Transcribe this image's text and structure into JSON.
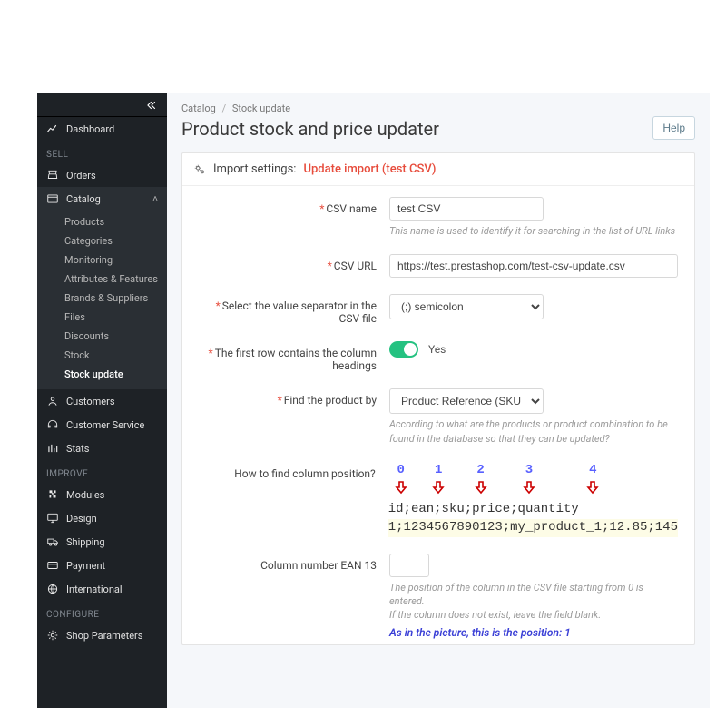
{
  "sidebar": {
    "dashboard": "Dashboard",
    "sections": {
      "sell": "SELL",
      "improve": "IMPROVE",
      "configure": "CONFIGURE"
    },
    "items": {
      "orders": "Orders",
      "catalog": "Catalog",
      "customers": "Customers",
      "customer_service": "Customer Service",
      "stats": "Stats",
      "modules": "Modules",
      "design": "Design",
      "shipping": "Shipping",
      "payment": "Payment",
      "international": "International",
      "shop_parameters": "Shop Parameters"
    },
    "catalog_sub": [
      "Products",
      "Categories",
      "Monitoring",
      "Attributes & Features",
      "Brands & Suppliers",
      "Files",
      "Discounts",
      "Stock",
      "Stock update"
    ]
  },
  "breadcrumb": {
    "a": "Catalog",
    "b": "Stock update"
  },
  "page_title": "Product stock and price updater",
  "help": "Help",
  "panel": {
    "lead": "Import settings:",
    "tag": "Update import (test CSV)"
  },
  "form": {
    "csv_name_label": "CSV name",
    "csv_name_value": "test CSV",
    "csv_name_hint": "This name is used to identify it for searching in the list of URL links",
    "csv_url_label": "CSV URL",
    "csv_url_value": "https://test.prestashop.com/test-csv-update.csv",
    "sep_label": "Select the value separator in the CSV file",
    "sep_value": "(;) semicolon",
    "first_row_label": "The first row contains the column headings",
    "first_row_value": "Yes",
    "find_by_label": "Find the product by",
    "find_by_value": "Product Reference (SKU)",
    "find_by_hint": "According to what are the products or product combination to be found in the database so that they can be updated?",
    "colpos_label": "How to find column position?",
    "nums": [
      "0",
      "1",
      "2",
      "3",
      "4"
    ],
    "csv_head": "id;ean;sku;price;quantity",
    "csv_row": "1;1234567890123;my_product_1;12.85;145",
    "ean_label": "Column number EAN 13",
    "ean_hint1": "The position of the column in the CSV file starting from 0 is entered.",
    "ean_hint2": "If the column does not exist, leave the field blank.",
    "ean_note": "As in the picture, this is the position: 1"
  }
}
